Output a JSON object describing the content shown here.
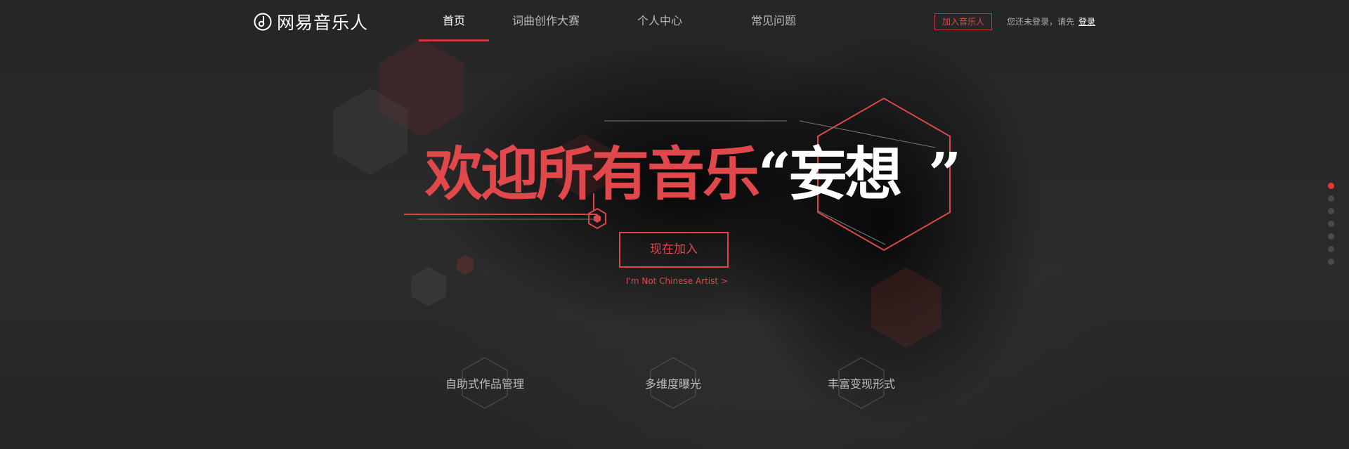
{
  "header": {
    "logo_text": "网易音乐人",
    "nav": [
      {
        "label": "首页",
        "active": true
      },
      {
        "label": "词曲创作大赛",
        "active": false
      },
      {
        "label": "个人中心",
        "active": false
      },
      {
        "label": "常见问题",
        "active": false
      }
    ],
    "join_button": "加入音乐人",
    "login_hint": "您还未登录，请先",
    "login_link": "登录"
  },
  "hero": {
    "title_red": "欢迎所有音乐",
    "quote_open": "“",
    "title_white": "妄想",
    "quote_close": "”",
    "cta_button": "现在加入",
    "not_chinese_link": "I'm Not Chinese Artist >"
  },
  "features": [
    {
      "label": "自助式作品管理"
    },
    {
      "label": "多维度曝光"
    },
    {
      "label": "丰富变现形式"
    }
  ],
  "slider": {
    "total": 7,
    "active_index": 0
  },
  "colors": {
    "accent": "#e0484b",
    "background": "#262626"
  }
}
